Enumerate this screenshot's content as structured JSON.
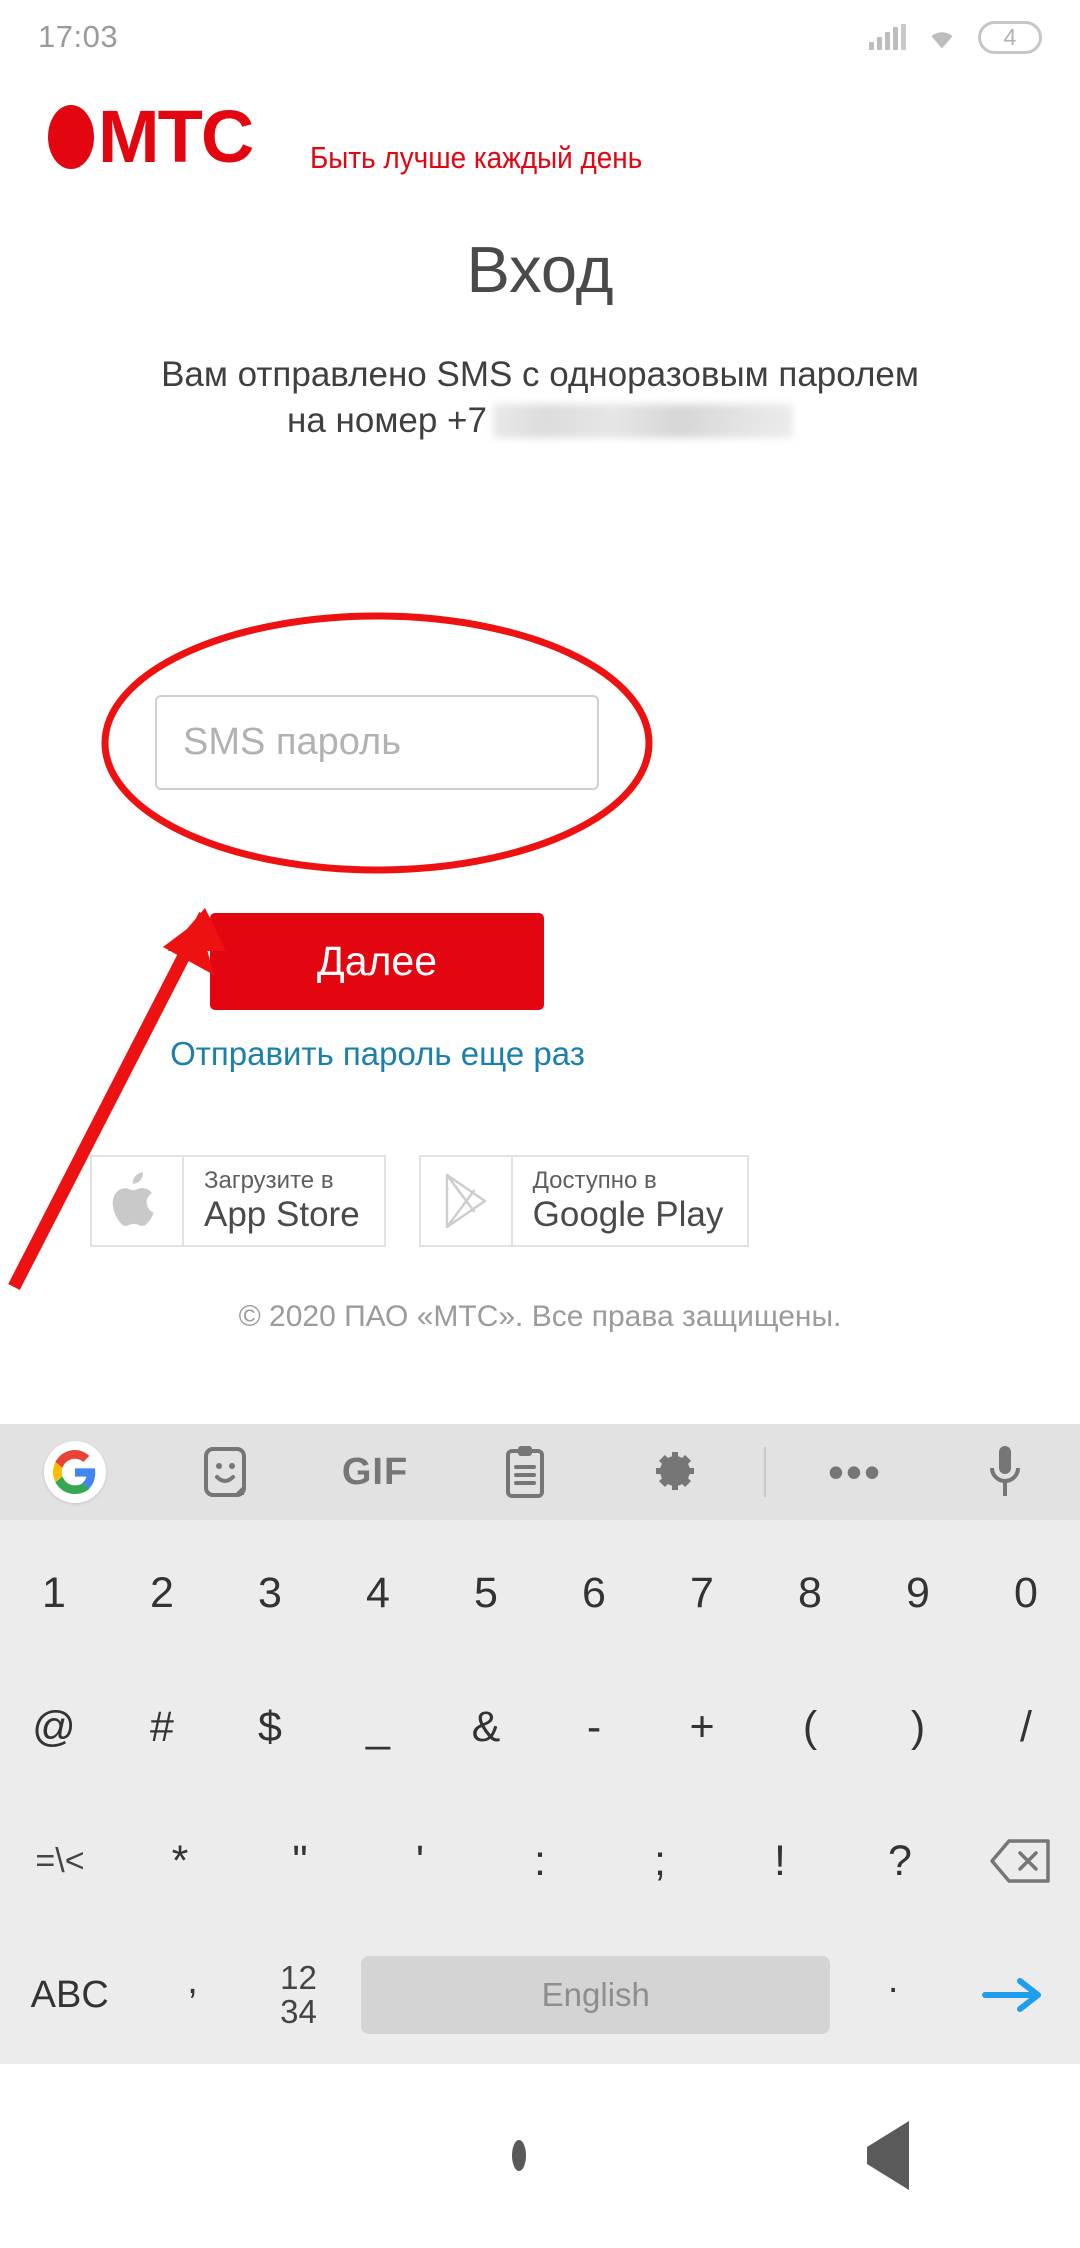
{
  "status_bar": {
    "time": "17:03",
    "signal_icon": "cellular-signal-icon",
    "wifi_icon": "wifi-icon",
    "battery_level": "4"
  },
  "brand": {
    "logo_text": "МТС",
    "logo_icon": "mts-egg-logo-icon",
    "slogan": "Быть лучше каждый день"
  },
  "page": {
    "title": "Вход",
    "subtitle_line1": "Вам отправлено SMS с одноразовым паролем",
    "subtitle_line2": "на номер +7",
    "phone_masked": ""
  },
  "form": {
    "sms_placeholder": "SMS пароль",
    "sms_value": "",
    "submit_label": "Далее",
    "resend_label": "Отправить пароль еще раз",
    "accent_color": "#E30611",
    "link_color": "#1B80AD"
  },
  "stores": [
    {
      "icon": "apple-logo-icon",
      "small": "Загрузите в",
      "big": "App Store"
    },
    {
      "icon": "google-play-icon",
      "small": "Доступно в",
      "big": "Google Play"
    }
  ],
  "footer": {
    "copyright": "© 2020 ПАО «МТС». Все права защищены."
  },
  "annotations": {
    "ellipse": "red-ellipse-highlight",
    "arrow": "red-arrow-pointer",
    "color": "#EE1111"
  },
  "keyboard": {
    "toolbar": [
      {
        "name": "google-logo-icon",
        "label": "G"
      },
      {
        "name": "sticker-icon",
        "label": ""
      },
      {
        "name": "gif-icon",
        "label": "GIF"
      },
      {
        "name": "clipboard-icon",
        "label": ""
      },
      {
        "name": "settings-gear-icon",
        "label": ""
      },
      {
        "name": "toolbar-divider",
        "label": ""
      },
      {
        "name": "more-options-icon",
        "label": "•••"
      },
      {
        "name": "microphone-icon",
        "label": ""
      }
    ],
    "row1": [
      "1",
      "2",
      "3",
      "4",
      "5",
      "6",
      "7",
      "8",
      "9",
      "0"
    ],
    "row2": [
      "@",
      "#",
      "$",
      "_",
      "&",
      "-",
      "+",
      "(",
      ")",
      "/"
    ],
    "row3_left": "=\\<",
    "row3": [
      "*",
      "\"",
      "'",
      ":",
      ";",
      "!",
      "?"
    ],
    "row3_backspace": "backspace-icon",
    "row4": {
      "abc": "ABC",
      "comma": ",",
      "numeric_top": "12",
      "numeric_bottom": "34",
      "space_label": "English",
      "period": ".",
      "enter": "enter-arrow-icon"
    }
  },
  "nav_bar": {
    "recents": "recents-square-icon",
    "home": "home-circle-icon",
    "back": "back-triangle-icon"
  }
}
